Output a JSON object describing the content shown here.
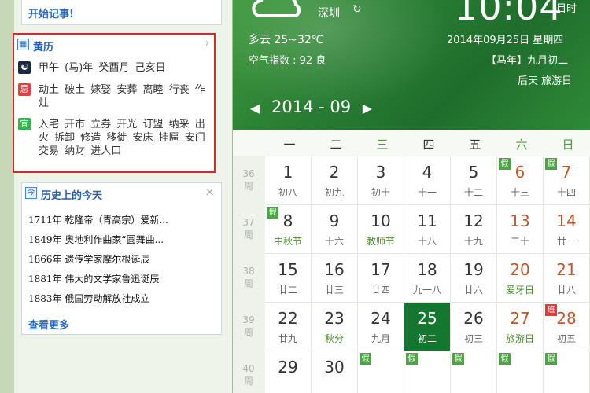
{
  "left": {
    "top_link": "开始记事!",
    "almanac": {
      "title": "黄历",
      "ganzhi": "甲午 (马)年 癸酉月 己亥日",
      "ji_label": "忌",
      "ji_text": "动土 破土 嫁娶 安葬 离睦 行丧 作灶",
      "yi_label": "宜",
      "yi_text": "入宅 开市 立券 开光 订盟 纳采 出火 拆卸 修造 移徙 安床 挂匾 安门 交易 纳财 进人口"
    },
    "history": {
      "title": "历史上的今天",
      "items": [
        {
          "year": "1711年",
          "text": "乾隆帝（青高宗）爱新..."
        },
        {
          "year": "1849年",
          "text": "奥地利作曲家“圆舞曲..."
        },
        {
          "year": "1866年",
          "text": "遗传学家摩尔根诞辰"
        },
        {
          "year": "1881年",
          "text": "伟大的文学家鲁迅诞辰"
        },
        {
          "year": "1883年",
          "text": "俄国劳动解放社成立"
        }
      ],
      "more": "查看更多"
    }
  },
  "header": {
    "time": "10:04",
    "time_suffix": "目时",
    "city": "深圳",
    "weather": "多云 25~32℃",
    "aqi": "空气指数 : 92 良",
    "date": "2014年09月25日  星期四",
    "lunar": "【马年】九月初二",
    "holiday": "后天  旅游日",
    "month_label": "2014 - 09",
    "prev_arrow": "◀",
    "next_arrow": "▶",
    "refresh_glyph": "↻"
  },
  "calendar": {
    "weekdays": [
      "一",
      "二",
      "三",
      "四",
      "五",
      "六",
      "日"
    ],
    "week_unit": "周",
    "weeks": [
      {
        "num": "36",
        "days": [
          {
            "d": "1",
            "s": "初八"
          },
          {
            "d": "2",
            "s": "初九"
          },
          {
            "d": "3",
            "s": "初十"
          },
          {
            "d": "4",
            "s": "十一"
          },
          {
            "d": "5",
            "s": "十二"
          },
          {
            "d": "6",
            "s": "十三",
            "tag": "假"
          },
          {
            "d": "7",
            "s": "十四",
            "tag": "假"
          }
        ]
      },
      {
        "num": "37",
        "days": [
          {
            "d": "8",
            "s": "中秋节",
            "tag": "假",
            "hi": true
          },
          {
            "d": "9",
            "s": "十六"
          },
          {
            "d": "10",
            "s": "教师节",
            "hi": true
          },
          {
            "d": "11",
            "s": "十八"
          },
          {
            "d": "12",
            "s": "十九"
          },
          {
            "d": "13",
            "s": "二十"
          },
          {
            "d": "14",
            "s": "廿一"
          }
        ]
      },
      {
        "num": "38",
        "days": [
          {
            "d": "15",
            "s": "廿二"
          },
          {
            "d": "16",
            "s": "廿三"
          },
          {
            "d": "17",
            "s": "廿四"
          },
          {
            "d": "18",
            "s": "九一八"
          },
          {
            "d": "19",
            "s": "廿六"
          },
          {
            "d": "20",
            "s": "爱牙日",
            "hi": true
          },
          {
            "d": "21",
            "s": "廿八"
          }
        ]
      },
      {
        "num": "39",
        "days": [
          {
            "d": "22",
            "s": "廿九"
          },
          {
            "d": "23",
            "s": "秋分",
            "hi": true
          },
          {
            "d": "24",
            "s": "九月"
          },
          {
            "d": "25",
            "s": "初二",
            "today": true
          },
          {
            "d": "26",
            "s": "初三"
          },
          {
            "d": "27",
            "s": "旅游日",
            "hi": true
          },
          {
            "d": "28",
            "s": "初五",
            "tag": "班"
          }
        ]
      },
      {
        "num": "40",
        "days": [
          {
            "d": "29",
            "s": ""
          },
          {
            "d": "30",
            "s": ""
          },
          {
            "d": "",
            "s": "",
            "tag": "假"
          },
          {
            "d": "",
            "s": "",
            "tag": "假"
          },
          {
            "d": "",
            "s": "",
            "tag": "假"
          },
          {
            "d": "",
            "s": "",
            "tag": "假"
          },
          {
            "d": "",
            "s": "",
            "tag": "假"
          }
        ]
      }
    ]
  },
  "colors": {
    "accent": "#2a7f33",
    "today": "#13772f",
    "highlight_border": "#d9272e",
    "link": "#2d69b8"
  }
}
